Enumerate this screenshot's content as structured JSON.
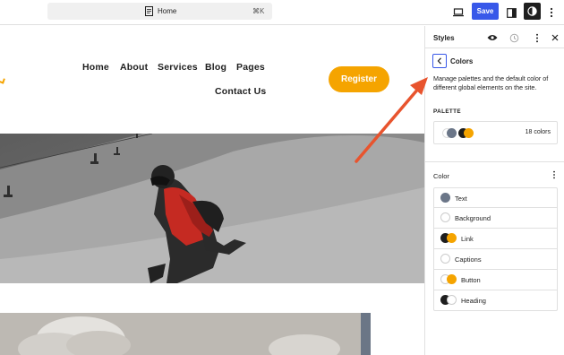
{
  "topbar": {
    "command_title": "Home",
    "command_shortcut": "⌘K",
    "save_label": "Save"
  },
  "site": {
    "nav": [
      "Home",
      "About",
      "Services",
      "Blog",
      "Pages",
      "Contact Us"
    ],
    "register_label": "Register"
  },
  "panel": {
    "title": "Styles",
    "section_title": "Colors",
    "description": "Manage palettes and the default color of different global elements on the site.",
    "palette_label": "PALETTE",
    "palette_count": "18 colors",
    "color_label": "Color",
    "color_items": [
      {
        "label": "Text"
      },
      {
        "label": "Background"
      },
      {
        "label": "Link"
      },
      {
        "label": "Captions"
      },
      {
        "label": "Button"
      },
      {
        "label": "Heading"
      }
    ]
  },
  "colors": {
    "accent": "#3858e9",
    "brand_yellow": "#f5a400",
    "annotation_arrow": "#e8542e"
  }
}
